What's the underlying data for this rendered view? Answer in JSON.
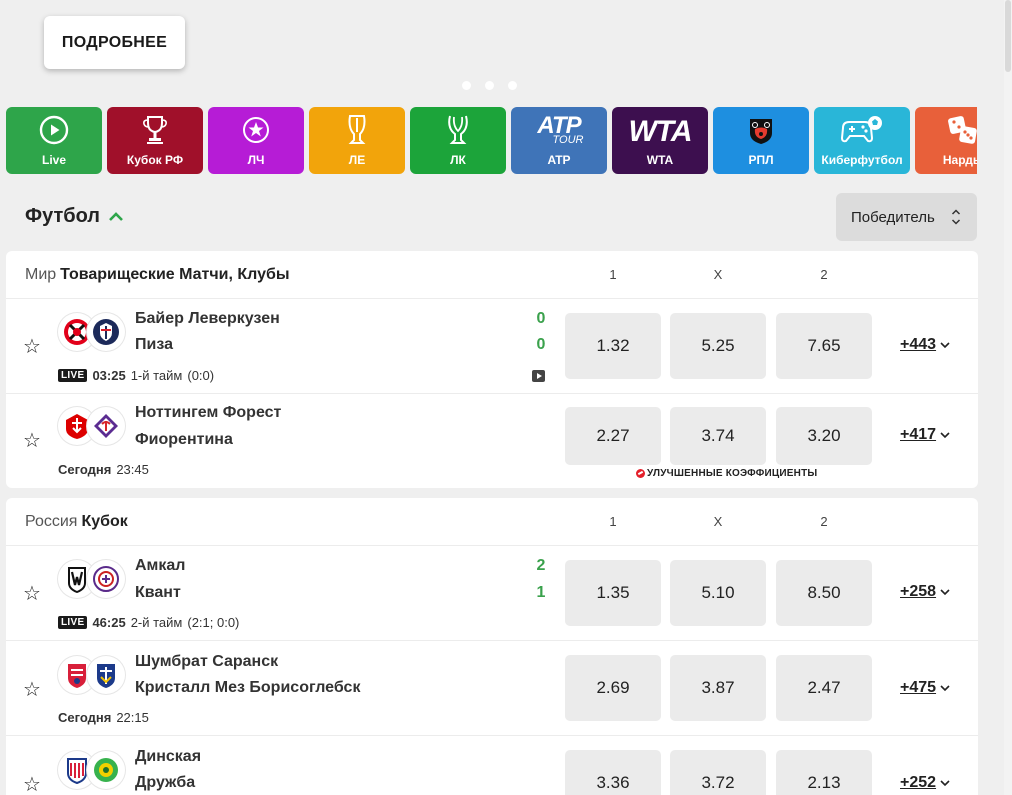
{
  "banner": {
    "more_label": "ПОДРОБНЕЕ"
  },
  "categories": [
    {
      "label": "Live",
      "color": "#2ea54a",
      "icon": "play-circle-icon"
    },
    {
      "label": "Кубок РФ",
      "color": "#a0102a",
      "icon": "cup-rf-icon"
    },
    {
      "label": "ЛЧ",
      "color": "#b61cd6",
      "icon": "champions-league-icon"
    },
    {
      "label": "ЛЕ",
      "color": "#f2a40b",
      "icon": "europa-league-icon"
    },
    {
      "label": "ЛК",
      "color": "#1ca43a",
      "icon": "conference-league-icon"
    },
    {
      "label": "ATP",
      "color": "#3f74b8",
      "icon": "atp-tour-logo",
      "logo_text": "ATP",
      "logo_sub": "TOUR"
    },
    {
      "label": "WTA",
      "color": "#3d0f4f",
      "icon": "wta-logo",
      "logo_text": "WTA"
    },
    {
      "label": "РПЛ",
      "color": "#1e8fe0",
      "icon": "rpl-bear-icon"
    },
    {
      "label": "Киберфутбол",
      "color": "#29b6d8",
      "icon": "gamepad-ball-icon"
    },
    {
      "label": "Нарды",
      "color": "#e8603a",
      "icon": "dice-icon"
    }
  ],
  "section": {
    "title": "Футбол",
    "sort_label": "Победитель"
  },
  "columns": [
    "1",
    "X",
    "2"
  ],
  "leagues": [
    {
      "country": "Мир",
      "name": "Товарищеские Матчи, Клубы",
      "matches": [
        {
          "home": "Байер Леверкузен",
          "away": "Пиза",
          "home_score": "0",
          "away_score": "0",
          "live": "LIVE",
          "time": "03:25",
          "period": "1-й тайм",
          "period_score": "(0:0)",
          "odds": [
            "1.32",
            "5.25",
            "7.65"
          ],
          "more": "+443"
        },
        {
          "home": "Ноттингем Форест",
          "away": "Фиорентина",
          "day": "Сегодня",
          "time": "23:45",
          "odds": [
            "2.27",
            "3.74",
            "3.20"
          ],
          "more": "+417",
          "boost": "УЛУЧШЕННЫЕ КОЭФФИЦИЕНТЫ"
        }
      ]
    },
    {
      "country": "Россия",
      "name": "Кубок",
      "matches": [
        {
          "home": "Амкал",
          "away": "Квант",
          "home_score": "2",
          "away_score": "1",
          "live": "LIVE",
          "time": "46:25",
          "period": "2-й тайм",
          "period_score": "(2:1; 0:0)",
          "odds": [
            "1.35",
            "5.10",
            "8.50"
          ],
          "more": "+258"
        },
        {
          "home": "Шумбрат Саранск",
          "away": "Кристалл Мез Борисоглебск",
          "day": "Сегодня",
          "time": "22:15",
          "odds": [
            "2.69",
            "3.87",
            "2.47"
          ],
          "more": "+475"
        },
        {
          "home": "Динская",
          "away": "Дружба",
          "odds": [
            "3.36",
            "3.72",
            "2.13"
          ],
          "more": "+252"
        }
      ]
    }
  ]
}
